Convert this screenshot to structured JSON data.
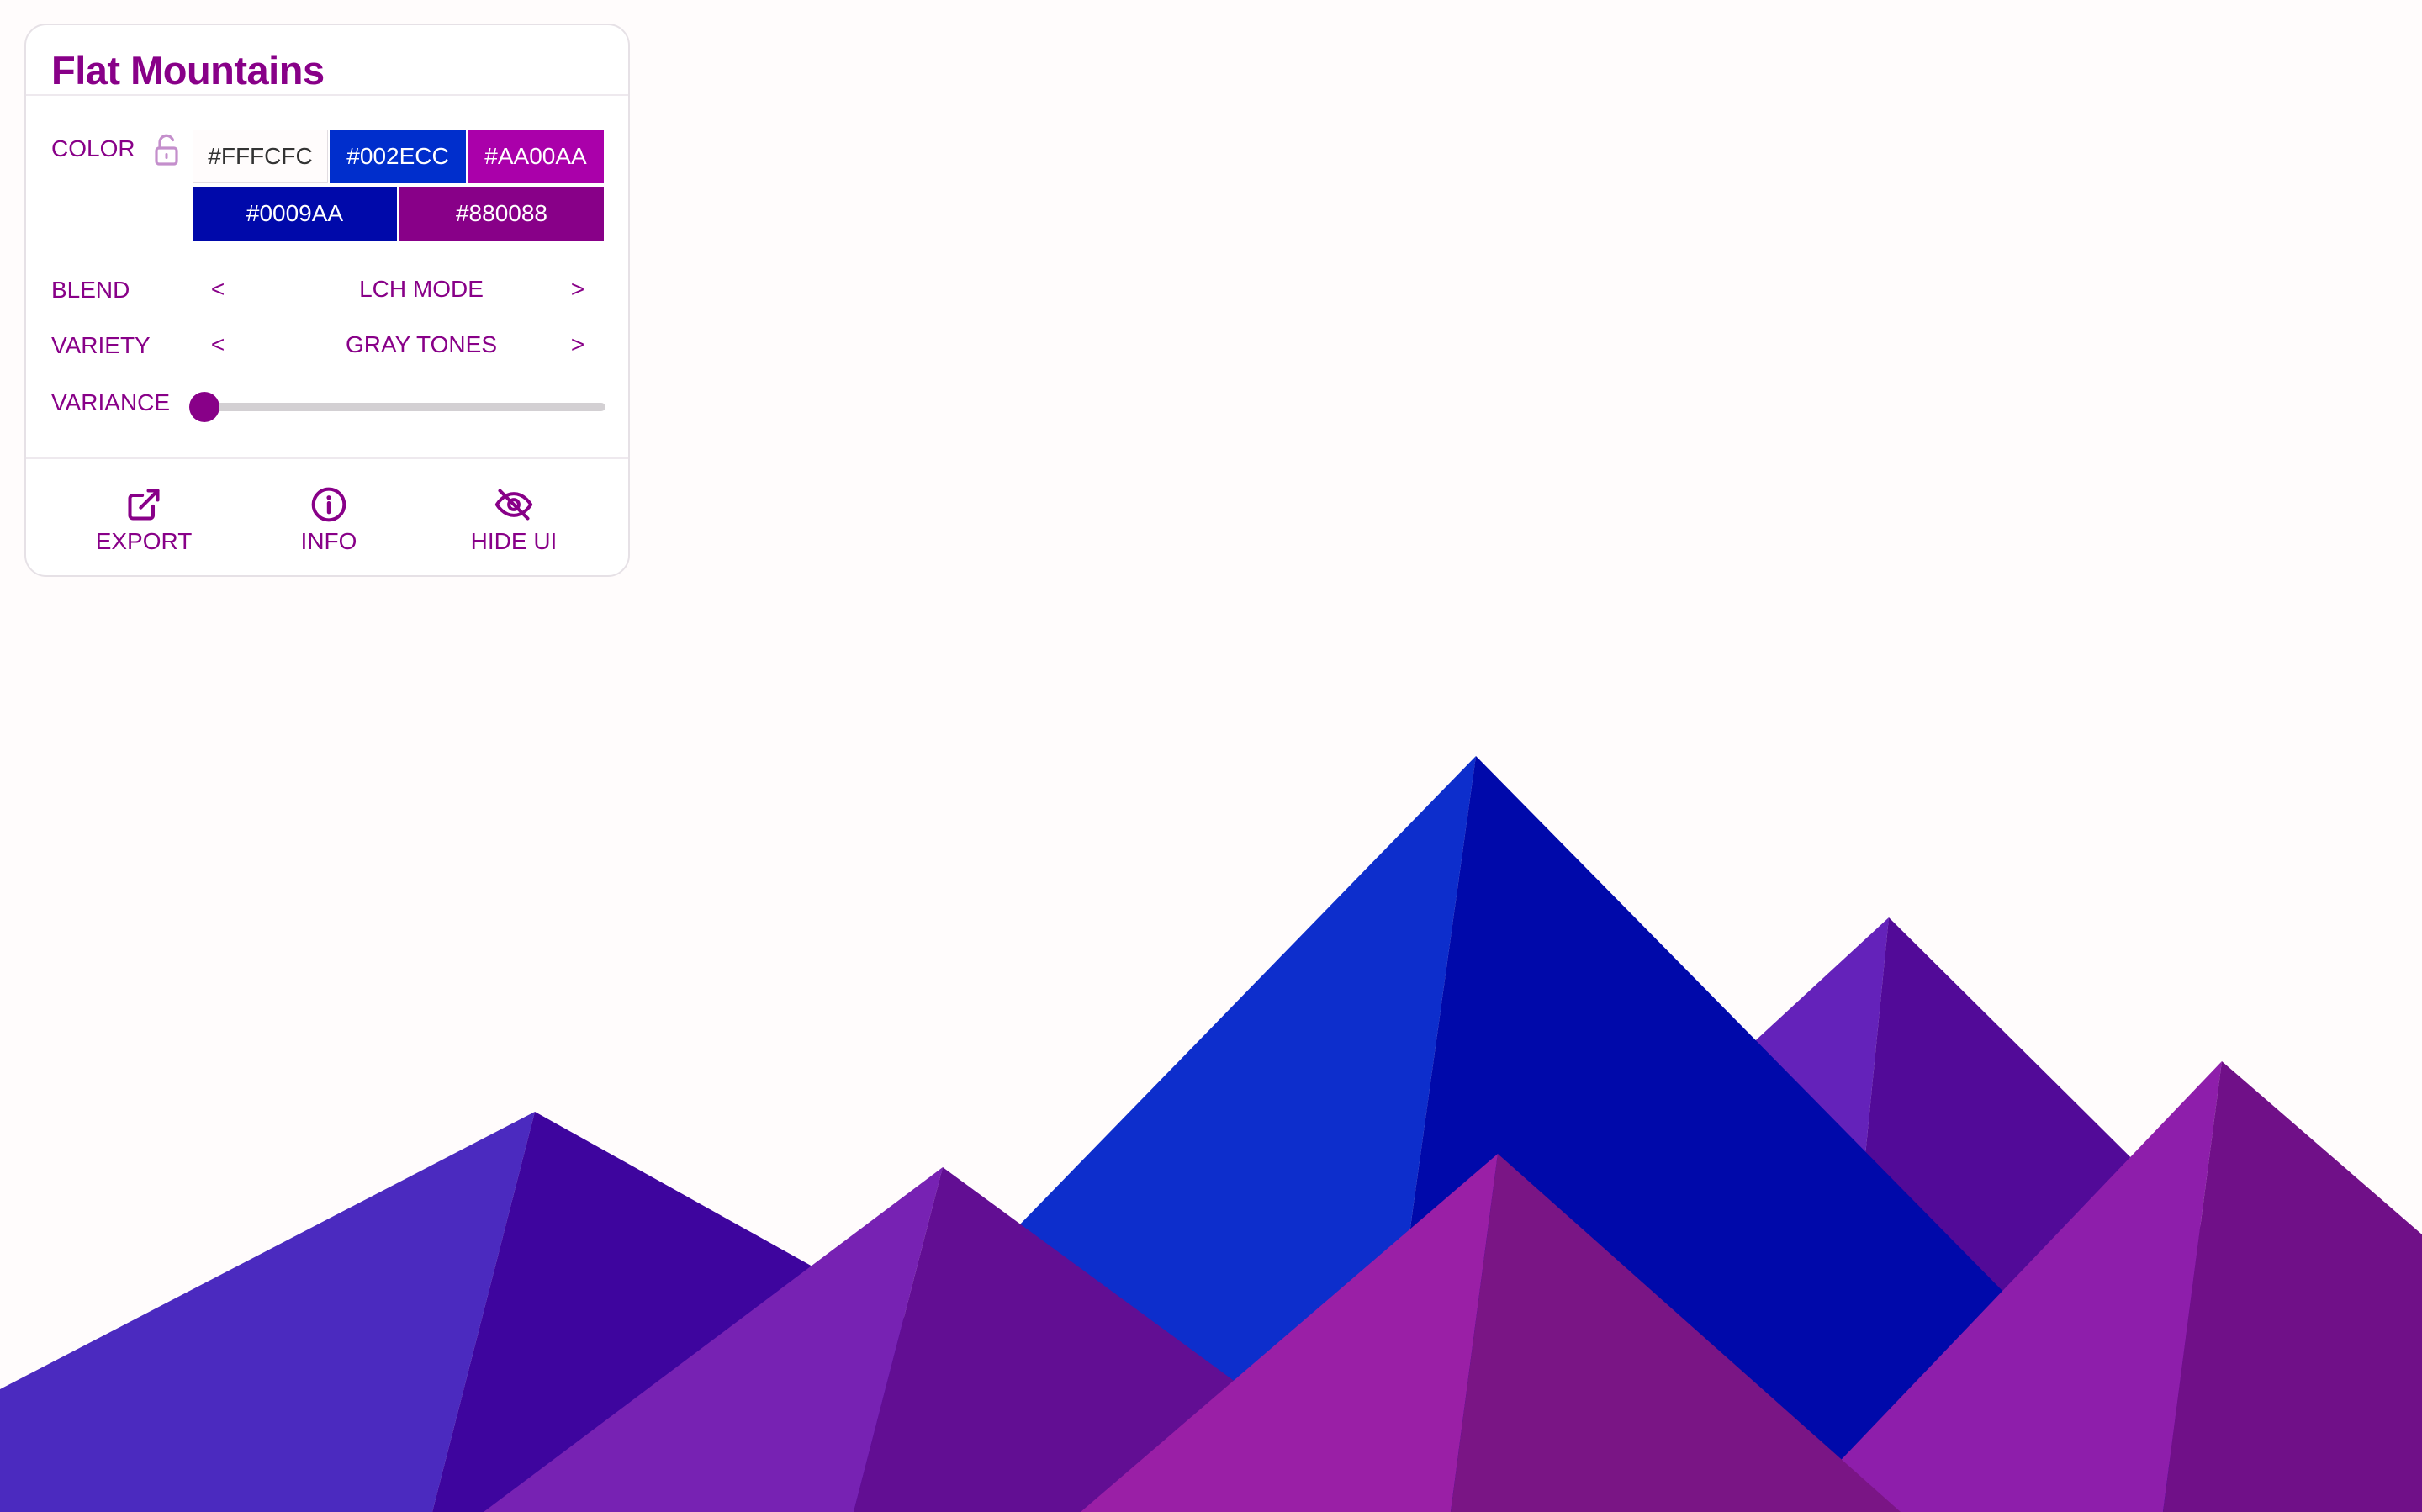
{
  "app": {
    "title": "Flat Mountains",
    "background_color": "#FFFCFC"
  },
  "panel": {
    "color_label": "COLOR",
    "lock_icon": "unlocked-padlock-icon",
    "swatches": [
      {
        "label": "#FFFCFC",
        "color": "#FFFCFC",
        "text_color": "#333333"
      },
      {
        "label": "#002ECC",
        "color": "#002ECC",
        "text_color": "#FFFFFF"
      },
      {
        "label": "#AA00AA",
        "color": "#AA00AA",
        "text_color": "#FFFFFF"
      },
      {
        "label": "#0009AA",
        "color": "#0009AA",
        "text_color": "#FFFFFF"
      },
      {
        "label": "#880088",
        "color": "#880088",
        "text_color": "#FFFFFF"
      }
    ],
    "blend": {
      "label": "BLEND",
      "prev": "<",
      "value": "LCH MODE",
      "next": ">"
    },
    "variety": {
      "label": "VARIETY",
      "prev": "<",
      "value": "GRAY TONES",
      "next": ">"
    },
    "variance": {
      "label": "VARIANCE",
      "value": 0,
      "min": 0,
      "max": 1
    },
    "actions": [
      {
        "label": "EXPORT",
        "icon": "external-link-icon"
      },
      {
        "label": "INFO",
        "icon": "info-circle-icon"
      },
      {
        "label": "HIDE UI",
        "icon": "eye-off-icon"
      }
    ]
  },
  "mountains": {
    "colors": {
      "m1_light": "#4B2ABF",
      "m1_dark": "#3E059E",
      "m2_light": "#0D2ECC",
      "m2_dark": "#0009AA",
      "m3_light": "#7722B3",
      "m3_dark": "#620E93",
      "m4_light": "#6422BA",
      "m4_dark": "#520A98",
      "m5_light": "#8E1EAB",
      "m5_dark": "#701088",
      "m6_light": "#9A1FA6",
      "m6_dark": "#7A1585"
    }
  }
}
